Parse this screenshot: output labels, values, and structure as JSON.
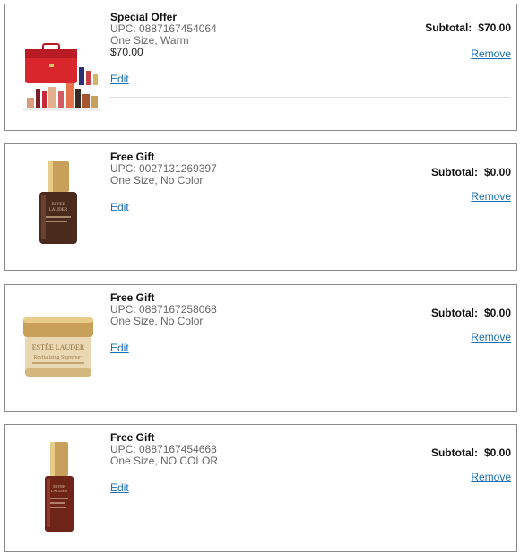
{
  "items": [
    {
      "type_label": "Special Offer",
      "upc": "UPC: 0887167454064",
      "variant": "One Size, Warm",
      "price": "$70.00",
      "edit_label": "Edit",
      "subtotal_label": "Subtotal:",
      "subtotal_value": "$70.00",
      "remove_label": "Remove",
      "image_icon": "makeup-gift-set-image"
    },
    {
      "type_label": "Free Gift",
      "upc": "UPC: 0027131269397",
      "variant": "One Size, No Color",
      "edit_label": "Edit",
      "subtotal_label": "Subtotal:",
      "subtotal_value": "$0.00",
      "remove_label": "Remove",
      "image_icon": "serum-bottle-image"
    },
    {
      "type_label": "Free Gift",
      "upc": "UPC: 0887167258068",
      "variant": "One Size, No Color",
      "edit_label": "Edit",
      "subtotal_label": "Subtotal:",
      "subtotal_value": "$0.00",
      "remove_label": "Remove",
      "image_icon": "cream-jar-image"
    },
    {
      "type_label": "Free Gift",
      "upc": "UPC: 0887167454668",
      "variant": "One Size, NO COLOR",
      "edit_label": "Edit",
      "subtotal_label": "Subtotal:",
      "subtotal_value": "$0.00",
      "remove_label": "Remove",
      "image_icon": "serum-bottle-image"
    }
  ],
  "colors": {
    "link": "#1a6fb5",
    "border": "#8a8a8a",
    "case_red": "#d8262c",
    "serum_brown": "#4a2a1c",
    "gold": "#c9a05a"
  }
}
